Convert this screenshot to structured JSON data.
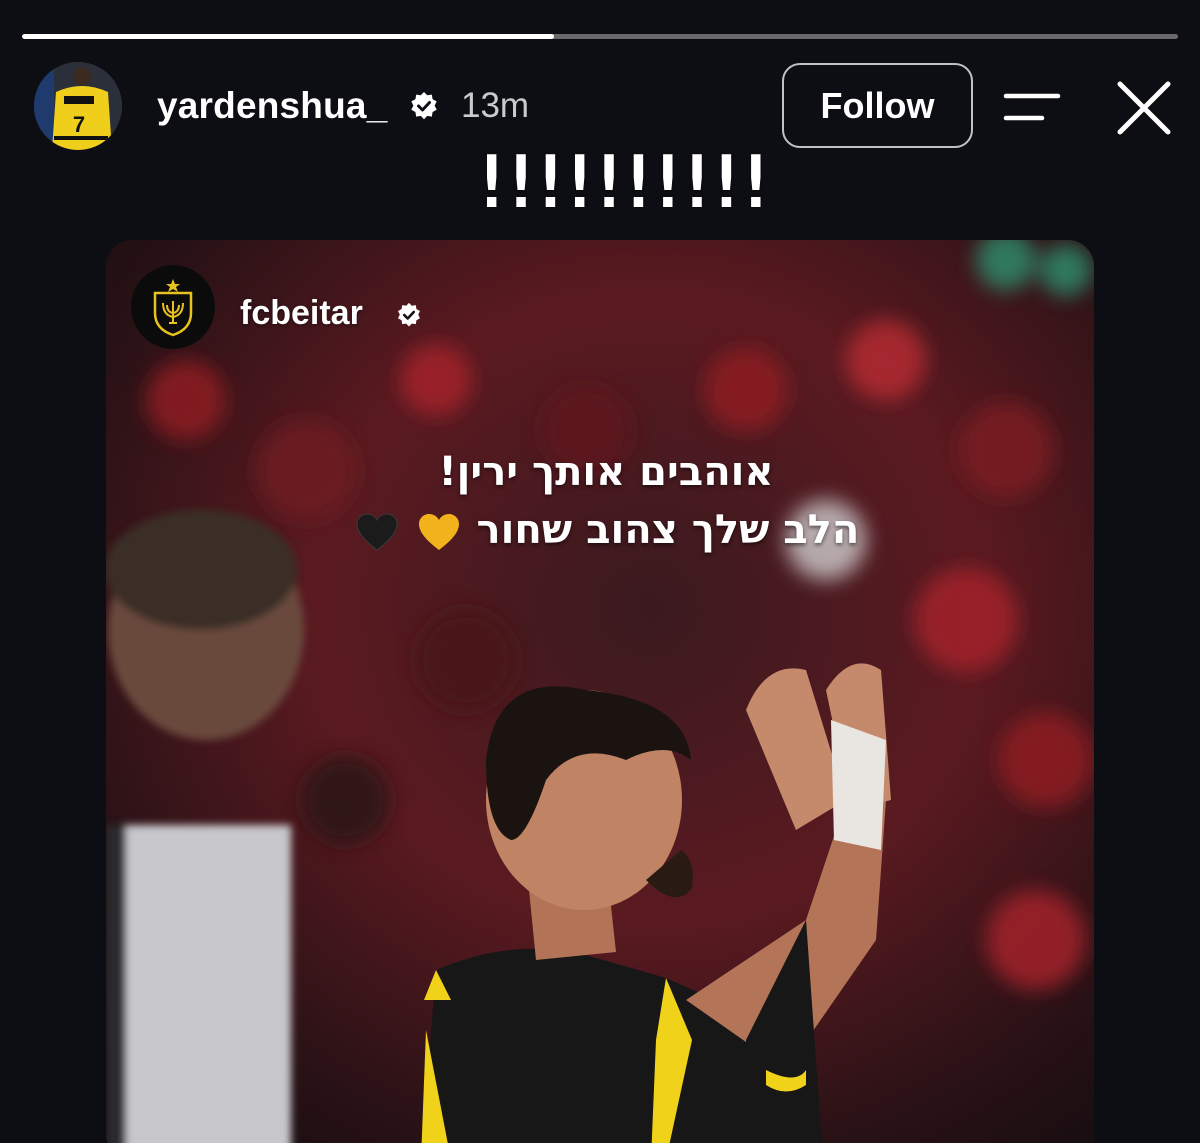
{
  "story": {
    "progress": 0.46,
    "colors": {
      "background": "#0d0e13",
      "progress_fill": "#ffffff",
      "progress_track": "rgba(255,255,255,0.38)",
      "jersey_yellow": "#f1d21a",
      "crowd_red": "#8e1a22"
    }
  },
  "header": {
    "username": "yardenshua_",
    "time_ago": "13m",
    "follow_label": "Follow",
    "avatar_icon": "profile-avatar",
    "verified_icon": "verified-badge-icon",
    "menu_icon": "menu-icon",
    "close_icon": "close-icon"
  },
  "overlay_text": "!!!!!!!!!!",
  "shared_post": {
    "username": "fcbeitar",
    "avatar_icon": "club-crest-logo",
    "caption_line_1": "אוהבים אותך ירין!",
    "caption_line_2": "הלב שלך צהוב שחור",
    "caption_hearts": [
      "yellow-heart-icon",
      "black-heart-icon"
    ]
  }
}
